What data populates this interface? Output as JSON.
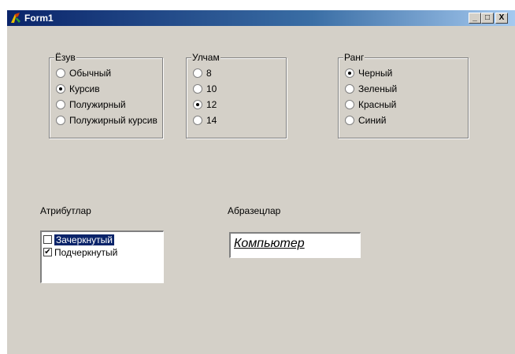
{
  "window": {
    "title": "Form1",
    "minimize": "_",
    "maximize": "□",
    "close": "X"
  },
  "groups": {
    "font_style": {
      "title": "Ёзув",
      "options": [
        {
          "label": "Обычный",
          "checked": false
        },
        {
          "label": "Курсив",
          "checked": true
        },
        {
          "label": "Полужирный",
          "checked": false
        },
        {
          "label": "Полужирный курсив",
          "checked": false
        }
      ]
    },
    "size": {
      "title": "Улчам",
      "options": [
        {
          "label": "8",
          "checked": false
        },
        {
          "label": "10",
          "checked": false
        },
        {
          "label": "12",
          "checked": true
        },
        {
          "label": "14",
          "checked": false
        }
      ]
    },
    "color": {
      "title": "Ранг",
      "options": [
        {
          "label": "Черный",
          "checked": true
        },
        {
          "label": "Зеленый",
          "checked": false
        },
        {
          "label": "Красный",
          "checked": false
        },
        {
          "label": "Синий",
          "checked": false
        }
      ]
    }
  },
  "attributes": {
    "label": "Атрибутлар",
    "items": [
      {
        "label": "Зачеркнутый",
        "checked": false,
        "selected": true
      },
      {
        "label": "Подчеркнутый",
        "checked": true,
        "selected": false
      }
    ]
  },
  "sample": {
    "label": "Абразецлар",
    "text": "Компьютер"
  }
}
